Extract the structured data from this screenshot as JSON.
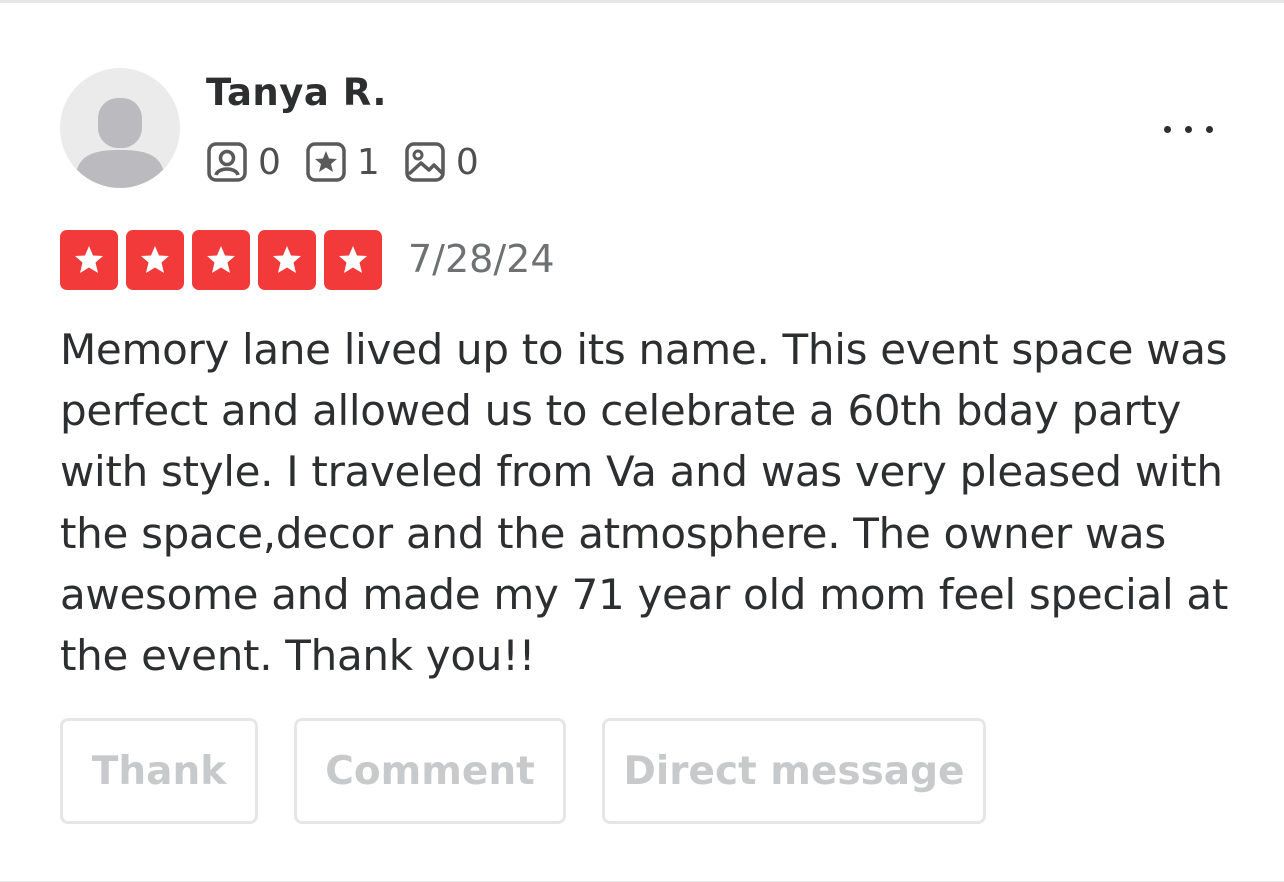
{
  "user": {
    "name": "Tanya R.",
    "avatar_icon": "default-user-avatar-icon"
  },
  "stats": {
    "friends": {
      "icon": "friends-icon",
      "count": "0"
    },
    "reviews": {
      "icon": "review-star-icon",
      "count": "1"
    },
    "photos": {
      "icon": "photo-icon",
      "count": "0"
    }
  },
  "menu": {
    "icon": "more-options-icon"
  },
  "review": {
    "rating": 5,
    "max_rating": 5,
    "star_color": "#f23a3a",
    "date": "7/28/24",
    "text": "Memory lane lived up to its name. This event space was perfect and allowed us to celebrate a 60th bday party with style. I traveled from Va and was very pleased with the space,decor and the atmosphere. The owner was awesome and made my 71 year old mom feel special at the event. Thank you!!"
  },
  "actions": {
    "thank_label": "Thank",
    "comment_label": "Comment",
    "direct_message_label": "Direct message"
  }
}
